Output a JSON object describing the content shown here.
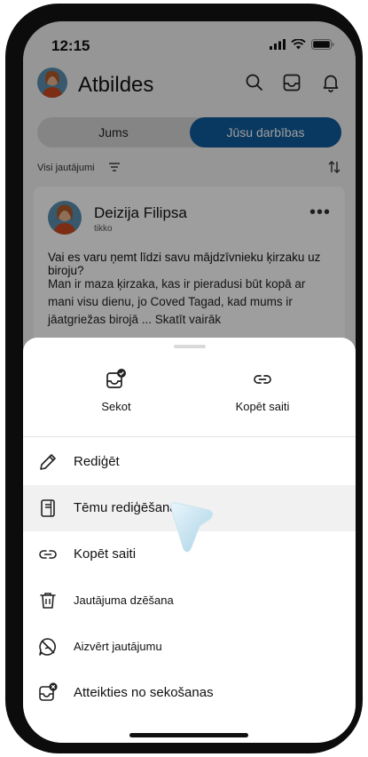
{
  "status": {
    "time": "12:15"
  },
  "header": {
    "title": "Atbildes"
  },
  "tabs": {
    "left": "Jums",
    "right": "Jūsu darbības",
    "active": "Jūsu darbības"
  },
  "filter": {
    "label": "Visi jautājumi"
  },
  "post": {
    "author": "Deizija Filipsa",
    "time": "tikko",
    "question": "Vai es varu ņemt līdzi savu mājdzīvnieku ķirzaku uz biroju?",
    "body": "Man ir maza ķirzaka, kas ir pieradusi būt kopā ar mani visu dienu, jo Coved Tagad, kad mums ir jāatgriežas birojā ... Skatīt vairāk"
  },
  "sheet": {
    "actions": [
      {
        "label": "Sekot",
        "icon": "follow-inbox-icon"
      },
      {
        "label": "Kopēt saiti",
        "icon": "link-icon"
      }
    ],
    "items": [
      {
        "label": "Rediģēt",
        "icon": "pencil-icon"
      },
      {
        "label": "Tēmu rediģēšana",
        "icon": "notebook-icon"
      },
      {
        "label": "Kopēt saiti",
        "icon": "link-icon"
      },
      {
        "label": "Jautājuma dzēšana",
        "icon": "trash-icon"
      },
      {
        "label": "Aizvērt jautājumu",
        "icon": "close-question-icon"
      },
      {
        "label": "Atteikties no sekošanas",
        "icon": "unfollow-icon"
      }
    ]
  },
  "colors": {
    "accent": "#0f5c9c",
    "highlight": "#f1f1f1"
  }
}
